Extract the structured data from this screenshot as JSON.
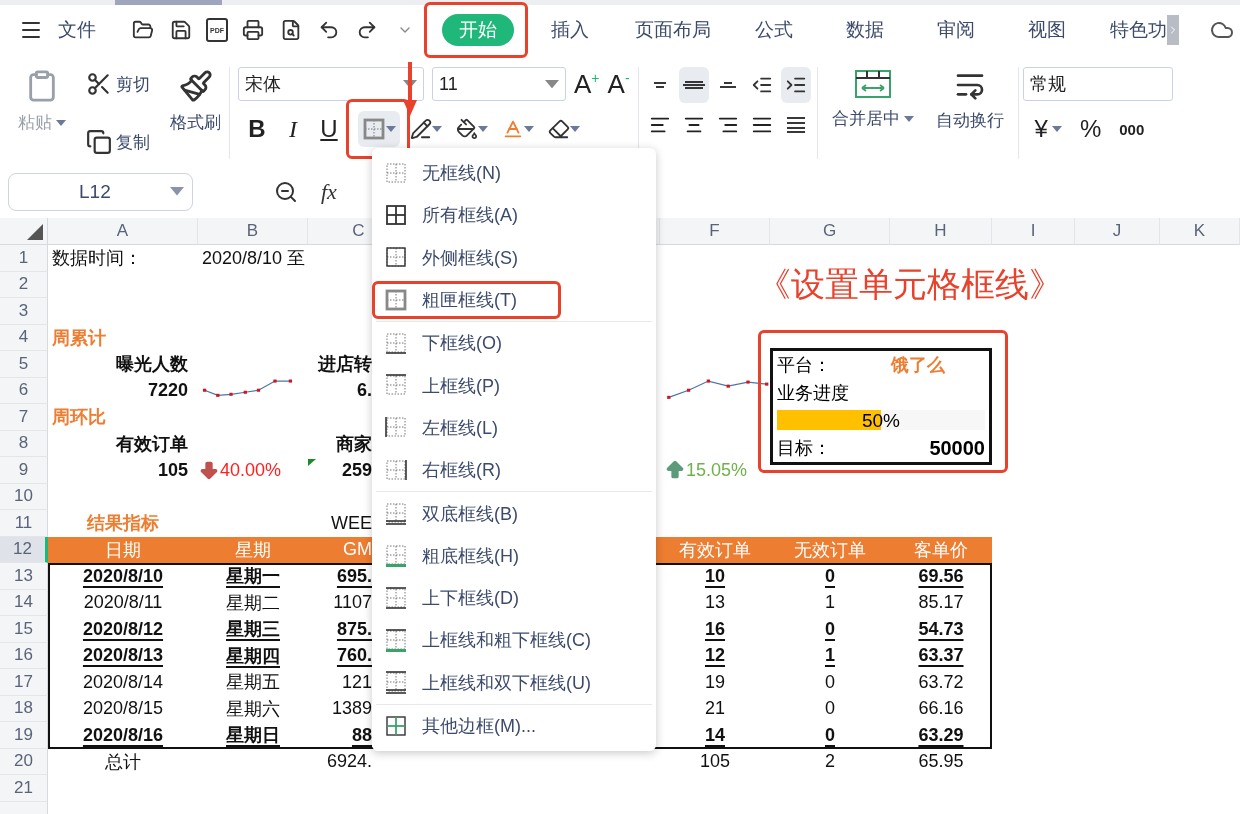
{
  "menu_bar": {
    "file_label": "文件",
    "pdf_label": "PDF",
    "tabs": [
      {
        "label": "开始",
        "selected": true,
        "annotated": true
      },
      {
        "label": "插入",
        "selected": false,
        "annotated": false
      },
      {
        "label": "页面布局",
        "selected": false,
        "annotated": false
      },
      {
        "label": "公式",
        "selected": false,
        "annotated": false
      },
      {
        "label": "数据",
        "selected": false,
        "annotated": false
      },
      {
        "label": "审阅",
        "selected": false,
        "annotated": false
      },
      {
        "label": "视图",
        "selected": false,
        "annotated": false
      },
      {
        "label": "特色功",
        "selected": false,
        "annotated": false
      }
    ]
  },
  "ribbon": {
    "paste": {
      "label": "粘贴",
      "disabled": true
    },
    "cut": "剪切",
    "copy": "复制",
    "format_painter": "格式刷",
    "font_name": "宋体",
    "font_size": "11",
    "grow_font": "A$^{+}$",
    "shrink_font": "A$^{-}$",
    "styles": [
      "B",
      "I",
      "U"
    ],
    "border_button": {
      "annotated": true
    },
    "vertical_align": [
      {
        "selected": false
      },
      {
        "selected": true
      },
      {
        "selected": false
      },
      {
        "selected": false
      },
      {
        "selected": true
      }
    ],
    "merge": "合并居中",
    "wrap": "自动换行",
    "number_format": "常规",
    "currency": "¥",
    "percent": "%",
    "thousands": "000"
  },
  "formula_bar": {
    "cell_ref": "L12",
    "fx": "fx"
  },
  "border_menu": {
    "groups": [
      [
        {
          "label": "无框线(N)",
          "annotated": false
        },
        {
          "label": "所有框线(A)",
          "annotated": false
        },
        {
          "label": "外侧框线(S)",
          "annotated": false
        },
        {
          "label": "粗匣框线(T)",
          "annotated": true
        }
      ],
      [
        {
          "label": "下框线(O)",
          "annotated": false
        },
        {
          "label": "上框线(P)",
          "annotated": false
        },
        {
          "label": "左框线(L)",
          "annotated": false
        },
        {
          "label": "右框线(R)",
          "annotated": false
        }
      ],
      [
        {
          "label": "双底框线(B)",
          "annotated": false
        },
        {
          "label": "粗底框线(H)",
          "annotated": false
        },
        {
          "label": "上下框线(D)",
          "annotated": false
        },
        {
          "label": "上框线和粗下框线(C)",
          "annotated": false
        },
        {
          "label": "上框线和双下框线(U)",
          "annotated": false
        }
      ],
      [
        {
          "label": "其他边框(M)...",
          "annotated": false
        }
      ]
    ]
  },
  "sheet": {
    "columns": [
      "A",
      "B",
      "C",
      "F",
      "G",
      "H",
      "I",
      "J",
      "K"
    ],
    "row_headers": [
      {
        "label": "1",
        "selected": false
      },
      {
        "label": "2",
        "selected": false
      },
      {
        "label": "3",
        "selected": false
      },
      {
        "label": "4",
        "selected": false
      },
      {
        "label": "5",
        "selected": false
      },
      {
        "label": "6",
        "selected": false
      },
      {
        "label": "7",
        "selected": false
      },
      {
        "label": "8",
        "selected": false
      },
      {
        "label": "9",
        "selected": false
      },
      {
        "label": "10",
        "selected": false
      },
      {
        "label": "11",
        "selected": false
      },
      {
        "label": "12",
        "selected": true
      },
      {
        "label": "13",
        "selected": false
      },
      {
        "label": "14",
        "selected": false
      },
      {
        "label": "15",
        "selected": false
      },
      {
        "label": "16",
        "selected": false
      },
      {
        "label": "17",
        "selected": false
      },
      {
        "label": "18",
        "selected": false
      },
      {
        "label": "19",
        "selected": false
      },
      {
        "label": "20",
        "selected": false
      },
      {
        "label": "21",
        "selected": false
      }
    ],
    "title": "《设置单元格框线》",
    "date_label": "数据时间：",
    "date_value": "2020/8/10 至",
    "weekly_total": {
      "heading": "周累计",
      "metrics": [
        {
          "label": "曝光人数",
          "value": "7220"
        },
        {
          "label": "进店转",
          "value": "6."
        }
      ]
    },
    "week_over_week": {
      "heading": "周环比",
      "metrics": [
        {
          "label": "有效订单",
          "value": "105",
          "change": "40.00%",
          "kind": "down"
        },
        {
          "label": "商家",
          "value": "259"
        }
      ],
      "extra_change": {
        "change": "15.05%",
        "kind": "up"
      }
    },
    "results": {
      "heading": "结果指标",
      "week_label": "WEE",
      "columns": [
        "日期",
        "星期",
        "GM",
        "有效订单",
        "无效订单",
        "客单价"
      ],
      "rows": [
        {
          "date": "2020/8/10",
          "weekday": "星期一",
          "gmv": "695.",
          "valid": "10",
          "invalid": "0",
          "price": "69.56",
          "bold": true
        },
        {
          "date": "2020/8/11",
          "weekday": "星期二",
          "gmv": "1107",
          "valid": "13",
          "invalid": "1",
          "price": "85.17",
          "bold": false
        },
        {
          "date": "2020/8/12",
          "weekday": "星期三",
          "gmv": "875.",
          "valid": "16",
          "invalid": "0",
          "price": "54.73",
          "bold": true
        },
        {
          "date": "2020/8/13",
          "weekday": "星期四",
          "gmv": "760.",
          "valid": "12",
          "invalid": "1",
          "price": "63.37",
          "bold": true
        },
        {
          "date": "2020/8/14",
          "weekday": "星期五",
          "gmv": "121",
          "valid": "19",
          "invalid": "0",
          "price": "63.72",
          "bold": false
        },
        {
          "date": "2020/8/15",
          "weekday": "星期六",
          "gmv": "1389",
          "valid": "21",
          "invalid": "0",
          "price": "66.16",
          "bold": false
        },
        {
          "date": "2020/8/16",
          "weekday": "星期日",
          "gmv": "88",
          "valid": "14",
          "invalid": "0",
          "price": "63.29",
          "bold": true
        }
      ],
      "total": {
        "label": "总计",
        "gmv": "6924.",
        "valid": "105",
        "invalid": "2",
        "price": "65.95"
      }
    },
    "info_card": {
      "platform_label": "平台：",
      "platform": "饿了么",
      "progress_label": "业务进度",
      "level": 0.5,
      "progress_text": "50%",
      "target_label": "目标：",
      "target": "50000",
      "annotated": true
    }
  }
}
